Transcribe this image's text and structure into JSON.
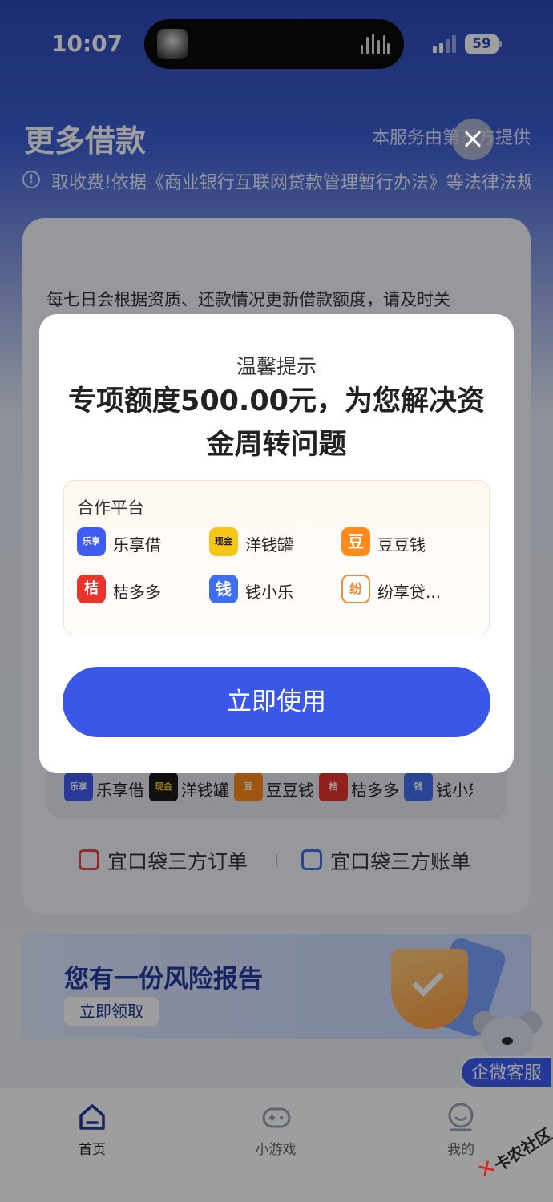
{
  "status_bar": {
    "time": "10:07",
    "battery": "59"
  },
  "header": {
    "title": "更多借款",
    "provider": "本服务由第三方提供",
    "notice": "取收费!依据《商业银行互联网贷款管理暂行办法》等法律法规"
  },
  "card": {
    "description": "每七日会根据资质、还款情况更新借款额度，请及时关",
    "platforms": [
      {
        "logo": "乐享",
        "label": "乐享借",
        "color": "#3f5bf0"
      },
      {
        "logo": "现金",
        "label": "洋钱罐",
        "color": "#f5c518"
      },
      {
        "logo": "豆",
        "label": "豆豆钱",
        "color": "#ff8a1e"
      },
      {
        "logo": "桔",
        "label": "桔多多",
        "color": "#e8342c"
      },
      {
        "logo": "钱",
        "label": "钱小乐",
        "color": "#3f6ff0"
      }
    ],
    "links": [
      "宜口袋三方订单",
      "宜口袋三方账单"
    ]
  },
  "risk_banner": {
    "title": "您有一份风险报告",
    "button": "立即领取"
  },
  "service_badge": "企微客服",
  "tabbar": [
    {
      "label": "首页",
      "icon": "home-icon",
      "active": true
    },
    {
      "label": "小游戏",
      "icon": "gamepad-icon",
      "active": false
    },
    {
      "label": "我的",
      "icon": "profile-icon",
      "active": false
    }
  ],
  "watermark": "卡农社区",
  "modal": {
    "subtitle": "温馨提示",
    "title": "专项额度500.00元，为您解决资金周转问题",
    "partner_heading": "合作平台",
    "partners": [
      {
        "logo": "乐享",
        "name": "乐享借",
        "color": "#3f5bf0"
      },
      {
        "logo": "现金",
        "name": "洋钱罐",
        "color": "#f5c518"
      },
      {
        "logo": "豆",
        "name": "豆豆钱",
        "color": "#ff8a1e"
      },
      {
        "logo": "桔",
        "name": "桔多多",
        "color": "#e8342c"
      },
      {
        "logo": "钱",
        "name": "钱小乐",
        "color": "#3f6ff0"
      },
      {
        "logo": "纷",
        "name": "纷享贷...",
        "color": "#f08a3c"
      }
    ],
    "button": "立即使用"
  }
}
